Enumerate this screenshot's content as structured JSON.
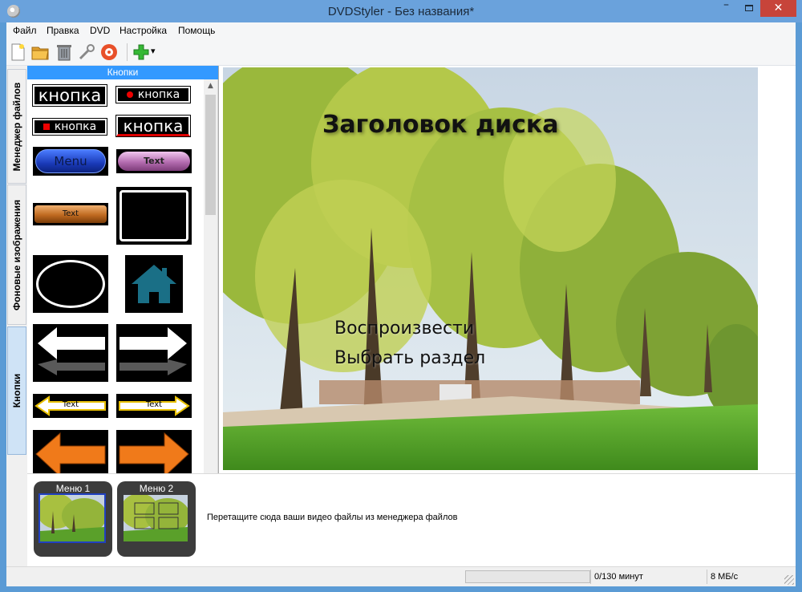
{
  "window": {
    "title": "DVDStyler - Без названия*",
    "controls": {
      "minimize": "–",
      "close": "✕"
    }
  },
  "menubar": {
    "items": [
      "Файл",
      "Правка",
      "DVD",
      "Настройка",
      "Помощь"
    ]
  },
  "toolbar": {
    "buttons": [
      {
        "icon": "new-document-icon"
      },
      {
        "icon": "open-folder-icon"
      },
      {
        "icon": "save-trash-icon"
      },
      {
        "icon": "settings-wrench-icon"
      },
      {
        "icon": "burn-disc-icon"
      },
      {
        "icon": "add-plus-icon"
      },
      {
        "icon": "dropdown-arrow-icon"
      }
    ],
    "dropdown_glyph": "▾",
    "plus_glyph": "✚"
  },
  "vtabs": {
    "items": [
      {
        "label": "Менеджер файлов",
        "active": false
      },
      {
        "label": "Фоновые изображения",
        "active": false
      },
      {
        "label": "Кнопки",
        "active": true
      }
    ]
  },
  "buttons_panel": {
    "header": "Кнопки",
    "samples": {
      "knopka": "кнопка",
      "menu": "Menu",
      "text": "Text"
    },
    "scroll_up": "▲",
    "scroll_down": "▼"
  },
  "preview": {
    "title": "Заголовок диска",
    "items": [
      "Воспроизвести",
      "Выбрать раздел"
    ]
  },
  "titleset": {
    "menus": [
      {
        "label": "Меню 1",
        "selected": true
      },
      {
        "label": "Меню 2",
        "selected": false
      }
    ],
    "hint": "Перетащите сюда ваши видео файлы из менеджера файлов"
  },
  "statusbar": {
    "duration": "0/130 минут",
    "bitrate": "8 МБ/с",
    "progress": 0
  },
  "colors": {
    "titlebar": "#6aa2dc",
    "panel_header": "#3399ff",
    "close_button": "#c7443a",
    "active_tab": "#cfe3f6"
  }
}
